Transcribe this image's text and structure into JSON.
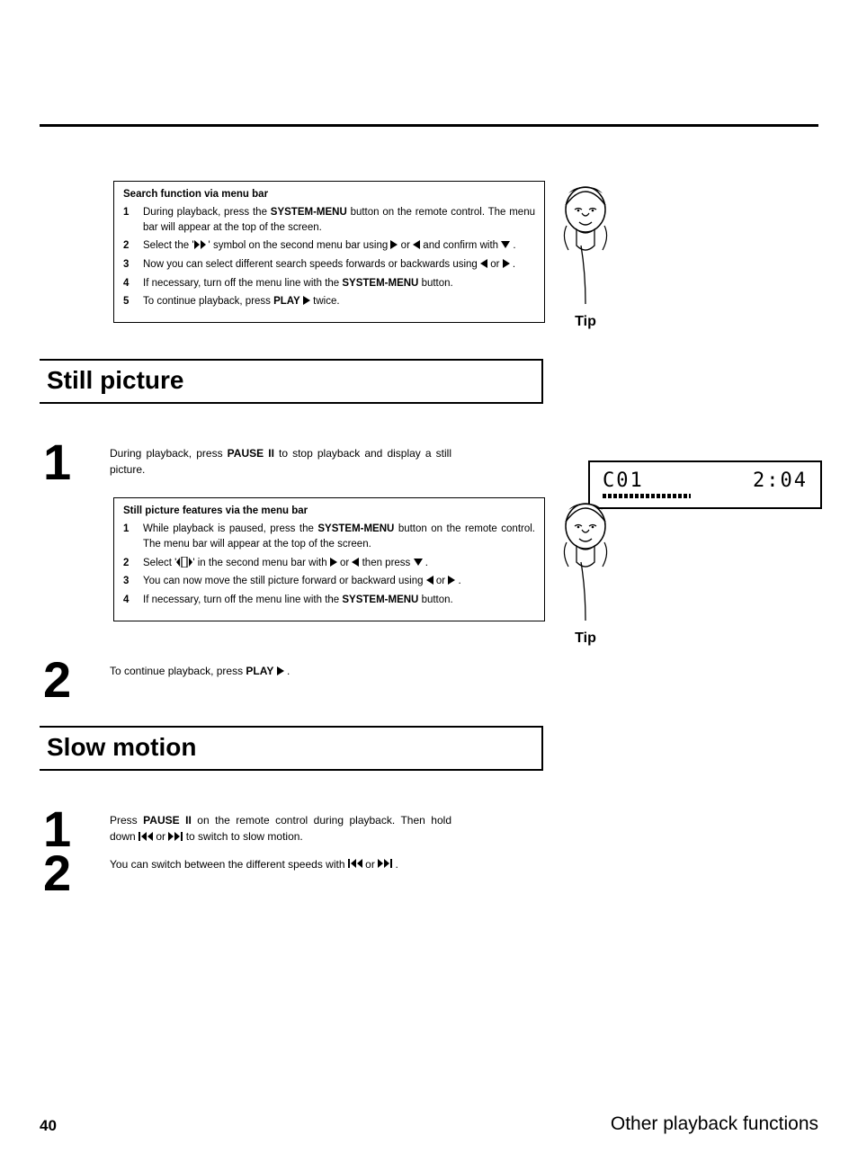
{
  "page_number": "40",
  "footer_title": "Other playback functions",
  "section1": {
    "tip_title": "Search function via menu bar",
    "tip_label": "Tip",
    "items": [
      {
        "n": "1",
        "pre": "During playback, press the ",
        "bold": "SYSTEM-MENU",
        "post": " button on the remote control. The menu bar will appear at the top of the screen."
      },
      {
        "n": "2",
        "text_html": "Select the '<svg class='icon' width='16' height='10'><polygon points='0,0 6,5 0,10' fill='#000'/><polygon points='7,0 13,5 7,10' fill='#000'/></svg>' symbol on the second menu bar using <svg class='icon' width='8' height='10'><polygon points='0,0 8,5 0,10' fill='#000'/></svg> or <svg class='icon' width='8' height='10'><polygon points='8,0 0,5 8,10' fill='#000'/></svg> and confirm with <svg class='icon' width='10' height='8'><polygon points='0,0 10,0 5,8' fill='#000'/></svg> ."
      },
      {
        "n": "3",
        "text_html": "Now you can select different search speeds forwards or backwards using <svg class='icon' width='8' height='10'><polygon points='8,0 0,5 8,10' fill='#000'/></svg> or <svg class='icon' width='8' height='10'><polygon points='0,0 8,5 0,10' fill='#000'/></svg> ."
      },
      {
        "n": "4",
        "pre": "If necessary, turn off the menu line with the ",
        "bold": "SYSTEM-MENU",
        "post": " button."
      },
      {
        "n": "5",
        "text_html": "To continue playback, press <b>PLAY</b> <svg class='icon' width='8' height='10'><polygon points='0,0 8,5 0,10' fill='#000'/></svg> twice."
      }
    ]
  },
  "heading_still": "Still picture",
  "still_step1": {
    "n": "1",
    "text_html": "During playback, press <b>PAUSE</b> <b>II</b> to stop playback and display a still picture."
  },
  "display": {
    "left": "C01",
    "right": "2:04"
  },
  "section2": {
    "tip_title": "Still picture features via the menu bar",
    "tip_label": "Tip",
    "items": [
      {
        "n": "1",
        "pre": "While playback is paused, press the ",
        "bold": "SYSTEM-MENU",
        "post": " button on the remote control. The menu bar will appear at the top of the screen."
      },
      {
        "n": "2",
        "text_html": "Select '<svg class='icon' width='18' height='12'><polygon points='4,1 0,6 4,11' fill='#000'/><rect x='6' y='0' width='6' height='12' fill='none' stroke='#000' stroke-width='1.2'/><polygon points='14,1 18,6 14,11' fill='#000'/></svg>' in the second menu bar with <svg class='icon' width='8' height='10'><polygon points='0,0 8,5 0,10' fill='#000'/></svg> or <svg class='icon' width='8' height='10'><polygon points='8,0 0,5 8,10' fill='#000'/></svg> then press <svg class='icon' width='10' height='8'><polygon points='0,0 10,0 5,8' fill='#000'/></svg> ."
      },
      {
        "n": "3",
        "text_html": "You can now move the still picture forward or backward using <svg class='icon' width='8' height='10'><polygon points='8,0 0,5 8,10' fill='#000'/></svg> or <svg class='icon' width='8' height='10'><polygon points='0,0 8,5 0,10' fill='#000'/></svg> ."
      },
      {
        "n": "4",
        "pre": "If necessary, turn off the menu line with the ",
        "bold": "SYSTEM-MENU",
        "post": " button."
      }
    ]
  },
  "still_step2": {
    "n": "2",
    "text_html": "To continue playback, press <b>PLAY</b> <svg class='icon' width='8' height='10'><polygon points='0,0 8,5 0,10' fill='#000'/></svg> ."
  },
  "heading_slow": "Slow motion",
  "slow_step1": {
    "n": "1",
    "text_html": "Press <b>PAUSE</b> <b>II</b> on the remote control during playback. Then hold down <svg class='icon' width='16' height='10'><rect x='0' y='0' width='2' height='10' fill='#000'/><polygon points='9,0 3,5 9,10' fill='#000'/><polygon points='16,0 10,5 16,10' fill='#000'/></svg> or <svg class='icon' width='16' height='10'><polygon points='0,0 6,5 0,10' fill='#000'/><polygon points='7,0 13,5 7,10' fill='#000'/><rect x='14' y='0' width='2' height='10' fill='#000'/></svg> to switch to slow motion."
  },
  "slow_step2": {
    "n": "2",
    "text_html": "You can switch between the different speeds with <svg class='icon' width='16' height='10'><rect x='0' y='0' width='2' height='10' fill='#000'/><polygon points='9,0 3,5 9,10' fill='#000'/><polygon points='16,0 10,5 16,10' fill='#000'/></svg> or <svg class='icon' width='16' height='10'><polygon points='0,0 6,5 0,10' fill='#000'/><polygon points='7,0 13,5 7,10' fill='#000'/><rect x='14' y='0' width='2' height='10' fill='#000'/></svg> ."
  }
}
